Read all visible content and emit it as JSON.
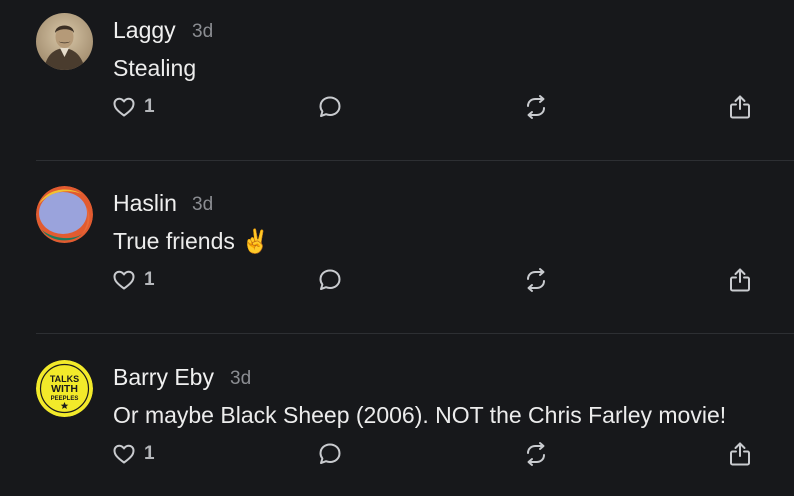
{
  "posts": [
    {
      "author": "Laggy",
      "time": "3d",
      "text": "Stealing",
      "likes": "1",
      "avatar_icon": "vintage-portrait-avatar"
    },
    {
      "author": "Haslin",
      "time": "3d",
      "text": "True friends ✌️",
      "likes": "1",
      "avatar_icon": "colorful-circle-avatar"
    },
    {
      "author": "Barry Eby",
      "time": "3d",
      "text": "Or maybe Black Sheep (2006). NOT the Chris Farley movie!",
      "likes": "1",
      "avatar_icon": "talks-with-peeples-logo-avatar",
      "avatar_text": [
        "TALKS",
        "WITH",
        "PEEPLES"
      ]
    }
  ],
  "actions": {
    "like_icon": "heart-icon",
    "reply_icon": "reply-bubble-icon",
    "repost_icon": "repost-icon",
    "share_icon": "share-icon"
  },
  "colors": {
    "background": "#17181b",
    "divider": "#2d2f33",
    "muted_text": "#8b8d92",
    "primary_text": "#ececec",
    "icon": "#c9cbcf"
  }
}
